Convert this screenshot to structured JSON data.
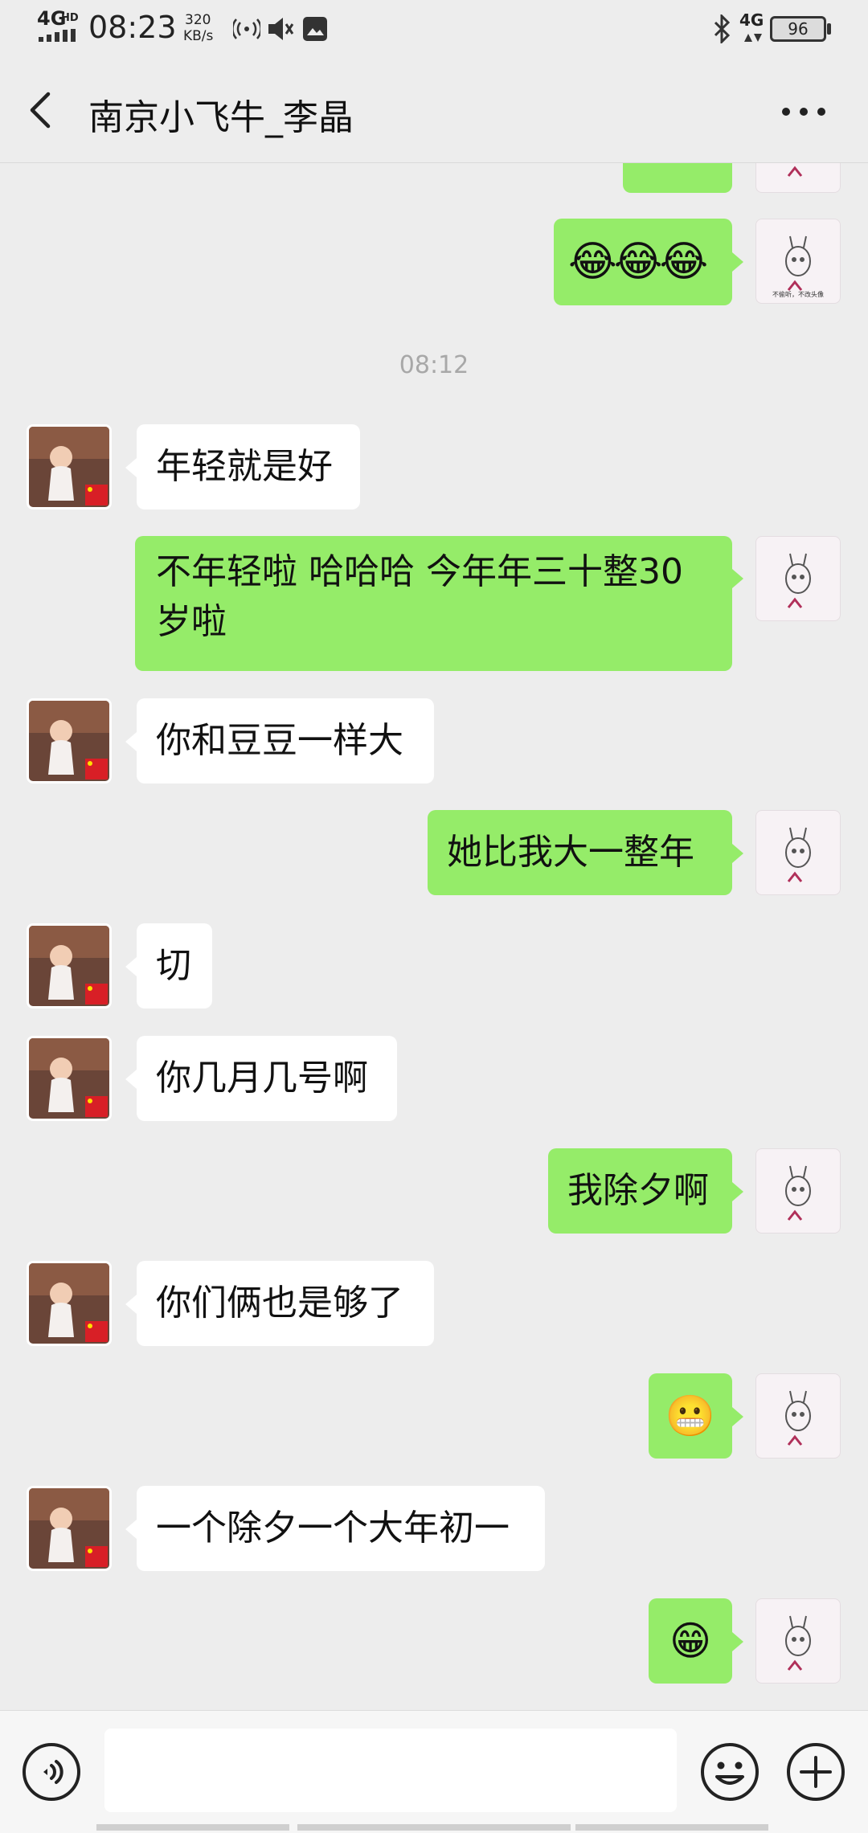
{
  "status_bar": {
    "network": "4G",
    "network_sup": "HD",
    "time": "08:23",
    "speed_value": "320",
    "speed_unit": "KB/s",
    "network_right": "4G",
    "battery": "96"
  },
  "header": {
    "title": "南京小飞牛_李晶"
  },
  "chat": {
    "timestamp": "08:12",
    "messages": [
      {
        "from": "me",
        "emoji": "😂😂😂"
      },
      {
        "from": "other",
        "text": "年轻就是好"
      },
      {
        "from": "me",
        "line1": "不年轻啦  哈哈哈  今年年三十整30",
        "line2": "岁啦"
      },
      {
        "from": "other",
        "text": "你和豆豆一样大"
      },
      {
        "from": "me",
        "text": "她比我大一整年"
      },
      {
        "from": "other",
        "text": "切"
      },
      {
        "from": "other",
        "text": "你几月几号啊"
      },
      {
        "from": "me",
        "text": "我除夕啊"
      },
      {
        "from": "other",
        "text": "你们俩也是够了"
      },
      {
        "from": "me",
        "emoji": "😬"
      },
      {
        "from": "other",
        "text": "一个除夕一个大年初一"
      },
      {
        "from": "me",
        "emoji": "😁"
      }
    ],
    "my_avatar_caption": "不偷听，不改头像"
  },
  "colors": {
    "bubble_me": "#95ec69",
    "bubble_other": "#ffffff",
    "background": "#ededed"
  },
  "icons": [
    "back-icon",
    "more-icon",
    "voice-icon",
    "emoji-icon",
    "plus-icon",
    "bluetooth-icon",
    "vibrate-icon",
    "battery-icon"
  ]
}
